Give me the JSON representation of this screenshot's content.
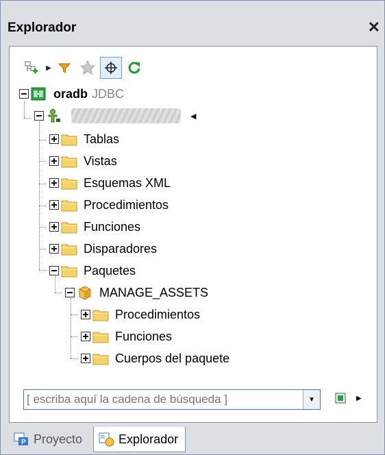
{
  "window": {
    "title": "Explorador",
    "close_glyph": "✕"
  },
  "toolbar": {
    "icons": [
      "add-datasource-icon",
      "expand-arrow-icon",
      "filter-icon",
      "favorites-star-icon",
      "locate-crosshair-icon",
      "refresh-icon"
    ]
  },
  "tree": {
    "root": {
      "label": "oradb",
      "type": "JDBC"
    },
    "schema_user_label": "",
    "folders": [
      "Tablas",
      "Vistas",
      "Esquemas XML",
      "Procedimientos",
      "Funciones",
      "Disparadores",
      "Paquetes"
    ],
    "package": {
      "label": "MANAGE_ASSETS",
      "children": [
        "Procedimientos",
        "Funciones",
        "Cuerpos del paquete"
      ]
    }
  },
  "search": {
    "placeholder": "[ escriba aquí la cadena de búsqueda ]"
  },
  "tabs": [
    {
      "label": "Proyecto",
      "active": false
    },
    {
      "label": "Explorador",
      "active": true
    }
  ],
  "colors": {
    "folder": "#f5d36b",
    "connection": "#3aa83a",
    "accent": "#3a7bd5"
  }
}
